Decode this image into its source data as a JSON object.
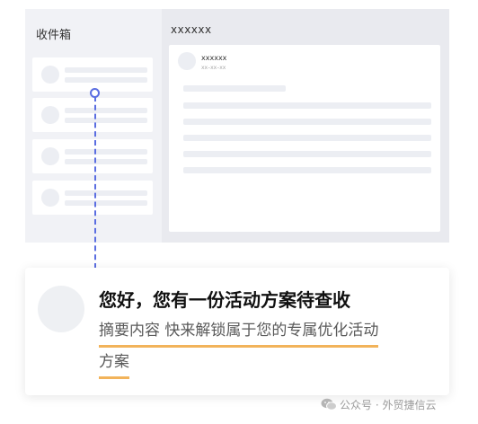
{
  "inbox": {
    "sidebar_title": "收件箱",
    "main_title": "xxxxxx",
    "sender_name": "xxxxxx",
    "sender_date": "xx–xx–xx"
  },
  "notification": {
    "title": "您好，您有一份活动方案待查收",
    "summary_line1": "摘要内容 快来解锁属于您的专属优化活动",
    "summary_line2": "方案"
  },
  "watermark": {
    "text": "公众号 · 外贸捷信云"
  },
  "colors": {
    "accent": "#5b6ee1",
    "underline": "#f2b35a",
    "placeholder": "#eceef3",
    "panel_bg": "#f1f2f6"
  }
}
